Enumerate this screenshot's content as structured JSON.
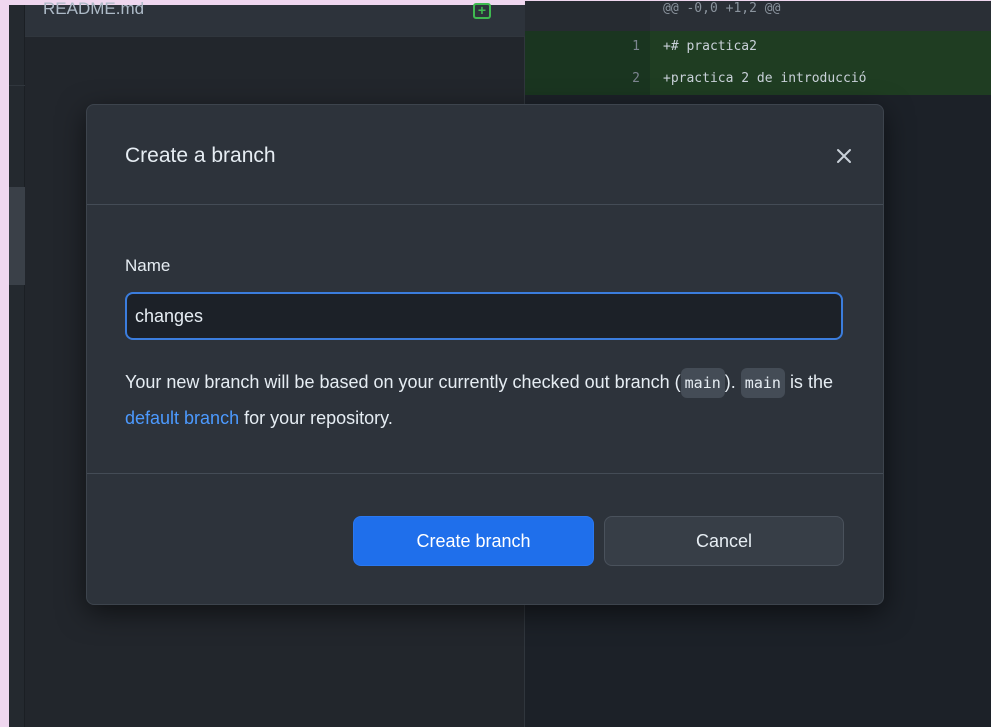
{
  "file_list": {
    "file_name": "README.md",
    "status_icon": "added-file-icon"
  },
  "diff": {
    "hunk_header": "@@ -0,0 +1,2 @@",
    "lines": [
      {
        "number": "1",
        "text": "+# practica2"
      },
      {
        "number": "2",
        "text": "+practica 2 de introducció"
      }
    ]
  },
  "dialog": {
    "title": "Create a branch",
    "close_icon": "close-icon",
    "name_label": "Name",
    "name_value": "changes",
    "description": {
      "part1": "Your new branch will be based on your currently checked out branch (",
      "branch_chip1": "main",
      "part2": ").",
      "branch_chip2": "main",
      "part3": "is the",
      "link_text": "default branch",
      "part4": "for your repository."
    },
    "create_button": "Create branch",
    "cancel_button": "Cancel"
  },
  "colors": {
    "accent": "#1f6feb",
    "link": "#4c9aff",
    "added": "#3fb950",
    "dialog_bg": "#2d333b"
  }
}
